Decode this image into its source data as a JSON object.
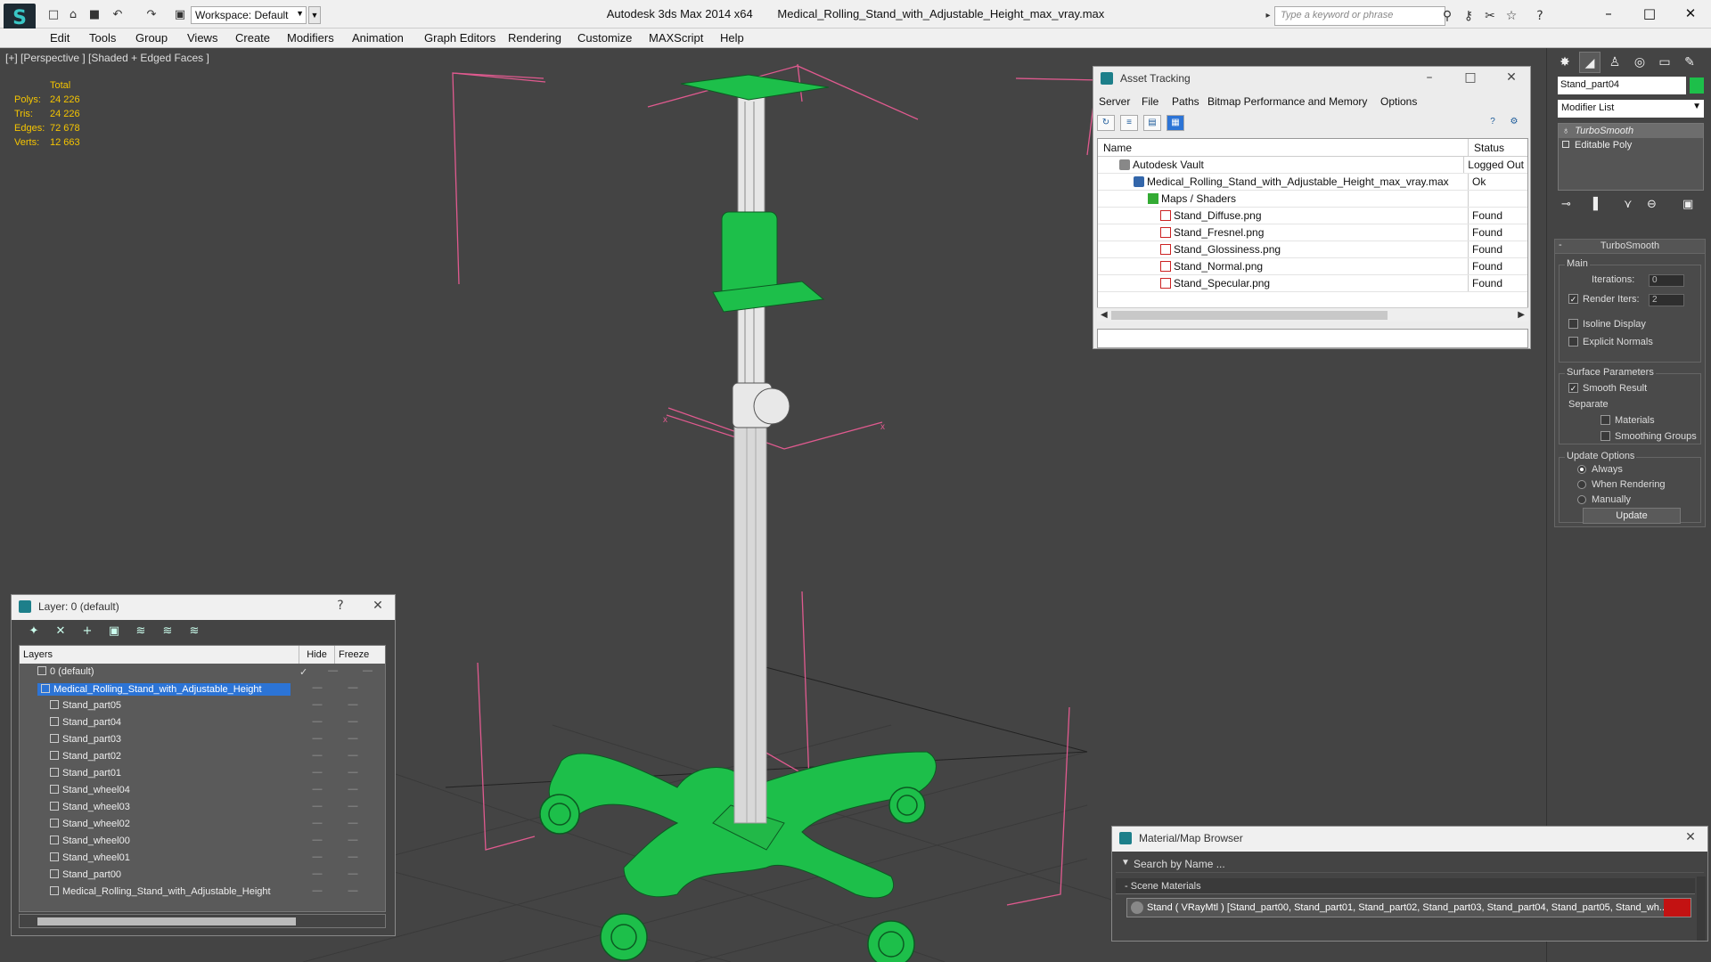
{
  "app": {
    "name": "Autodesk 3ds Max  2014 x64",
    "file": "Medical_Rolling_Stand_with_Adjustable_Height_max_vray.max",
    "workspace": "Workspace: Default",
    "search_placeholder": "Type a keyword or phrase"
  },
  "menu": [
    "Edit",
    "Tools",
    "Group",
    "Views",
    "Create",
    "Modifiers",
    "Animation",
    "Graph Editors",
    "Rendering",
    "Customize",
    "MAXScript",
    "Help"
  ],
  "viewport": {
    "label": "[+] [Perspective ] [Shaded + Edged Faces ]",
    "stats": {
      "header": "Total",
      "rows": [
        {
          "k": "Polys:",
          "v": "24 226"
        },
        {
          "k": "Tris:",
          "v": "24 226"
        },
        {
          "k": "Edges:",
          "v": "72 678"
        },
        {
          "k": "Verts:",
          "v": "12 663"
        }
      ]
    },
    "accent_green": "#1dbf4a",
    "bbox_pink": "#e05a8f"
  },
  "asset_tracking": {
    "title": "Asset Tracking",
    "menu": [
      "Server",
      "File",
      "Paths",
      "Bitmap Performance and Memory",
      "Options"
    ],
    "columns": {
      "name": "Name",
      "status": "Status"
    },
    "rows": [
      {
        "name": "Autodesk Vault",
        "status": "Logged Out"
      },
      {
        "name": "Medical_Rolling_Stand_with_Adjustable_Height_max_vray.max",
        "status": "Ok"
      },
      {
        "name": "Maps / Shaders",
        "status": ""
      },
      {
        "name": "Stand_Diffuse.png",
        "status": "Found"
      },
      {
        "name": "Stand_Fresnel.png",
        "status": "Found"
      },
      {
        "name": "Stand_Glossiness.png",
        "status": "Found"
      },
      {
        "name": "Stand_Normal.png",
        "status": "Found"
      },
      {
        "name": "Stand_Specular.png",
        "status": "Found"
      }
    ]
  },
  "layers": {
    "title": "Layer: 0 (default)",
    "help": "?",
    "columns": {
      "layers": "Layers",
      "hide": "Hide",
      "freeze": "Freeze"
    },
    "items": [
      "0 (default)",
      "Medical_Rolling_Stand_with_Adjustable_Height",
      "Stand_part05",
      "Stand_part04",
      "Stand_part03",
      "Stand_part02",
      "Stand_part01",
      "Stand_wheel04",
      "Stand_wheel03",
      "Stand_wheel02",
      "Stand_wheel00",
      "Stand_wheel01",
      "Stand_part00",
      "Medical_Rolling_Stand_with_Adjustable_Height"
    ]
  },
  "command_panel": {
    "object_name": "Stand_part04",
    "object_color": "#1dbf4a",
    "modifier_list": "Modifier List",
    "stack": [
      "TurboSmooth",
      "Editable Poly"
    ],
    "turbosmooth": {
      "title": "TurboSmooth",
      "main": "Main",
      "iterations_label": "Iterations:",
      "iterations_value": "0",
      "render_iters_label": "Render Iters:",
      "render_iters_value": "2",
      "isoline": "Isoline Display",
      "explicit": "Explicit Normals",
      "surface": "Surface Parameters",
      "smooth_result": "Smooth Result",
      "separate": "Separate",
      "materials": "Materials",
      "smoothing_groups": "Smoothing Groups",
      "update_options": "Update Options",
      "always": "Always",
      "when_rendering": "When Rendering",
      "manually": "Manually",
      "update": "Update"
    }
  },
  "material_browser": {
    "title": "Material/Map Browser",
    "search": "Search by Name ...",
    "group": "Scene Materials",
    "item": "Stand  ( VRayMtl )  [Stand_part00, Stand_part01, Stand_part02, Stand_part03, Stand_part04, Stand_part05, Stand_wh..."
  }
}
